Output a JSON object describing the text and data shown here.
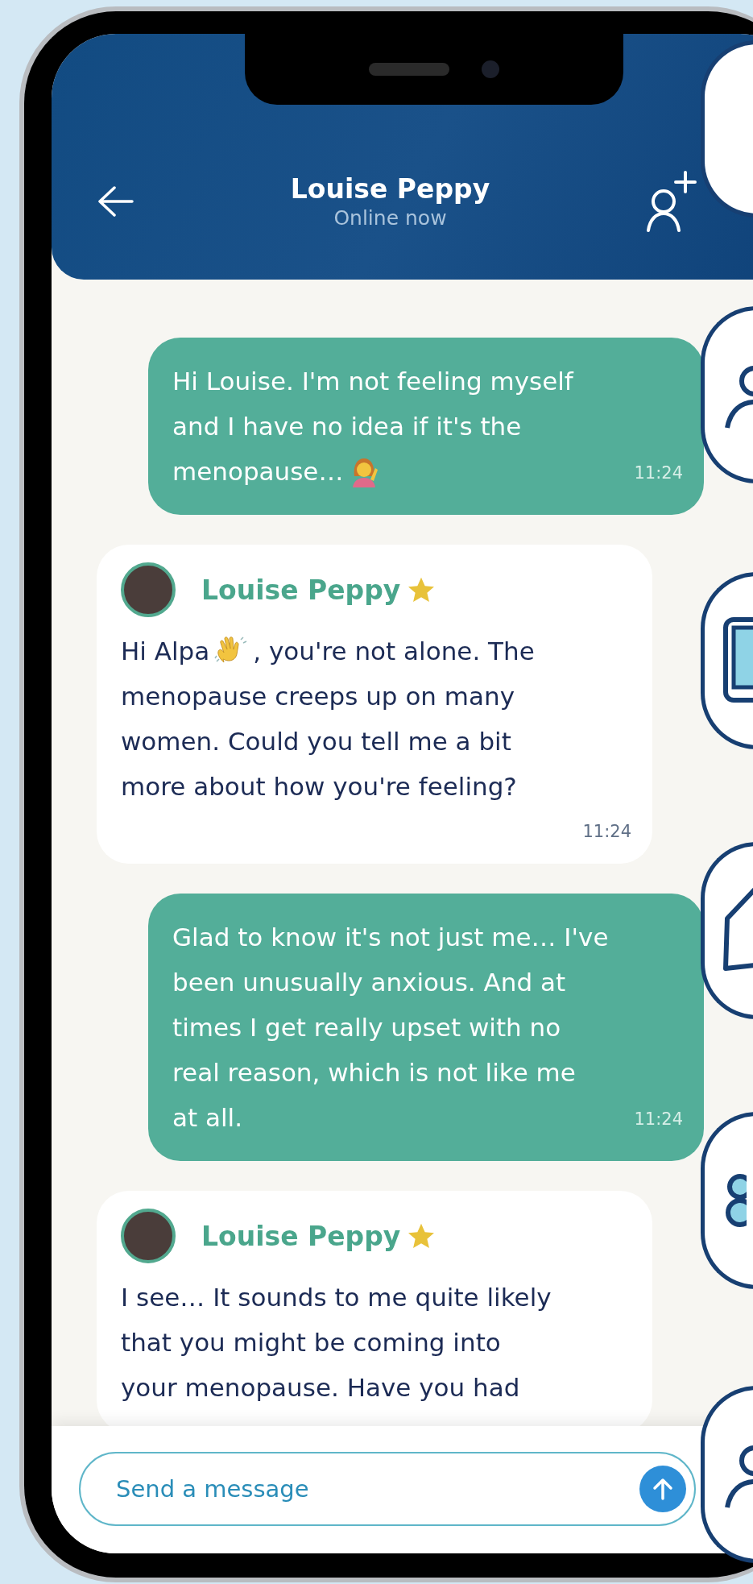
{
  "header": {
    "title": "Louise Peppy",
    "subtitle": "Online now"
  },
  "messages": [
    {
      "kind": "sent",
      "rows": [
        [
          {
            "kind": "text",
            "text": "Hi Louise. I'm not feeling myself\nand I have no idea if it's the"
          }
        ],
        [
          {
            "kind": "text",
            "text": "menopause…"
          },
          {
            "kind": "woman-emoji"
          }
        ]
      ],
      "time": "11:24"
    },
    {
      "kind": "received",
      "sender": "Louise Peppy",
      "starred": true,
      "rows": [
        [
          {
            "kind": "text",
            "text": "Hi Alpa"
          },
          {
            "kind": "wave-emoji"
          },
          {
            "kind": "text",
            "text": ", you're not alone. The"
          }
        ],
        [
          {
            "kind": "text",
            "text": "menopause creeps up on many\nwomen. Could you tell me a bit\nmore about how you're feeling?"
          }
        ]
      ],
      "time": "11:24"
    },
    {
      "kind": "sent",
      "rows": [
        [
          {
            "kind": "text",
            "text": "Glad to know it's not just me… I've\nbeen unusually anxious. And at\ntimes I get really upset with no\nreal reason, which is not like me\nat all."
          }
        ]
      ],
      "time": "11:24"
    },
    {
      "kind": "received",
      "sender": "Louise Peppy",
      "starred": true,
      "rows": [
        [
          {
            "kind": "text",
            "text": "I see… It sounds to me quite likely\nthat you might be coming into\nyour menopause. Have you had"
          }
        ]
      ]
    }
  ],
  "composer": {
    "placeholder": "Send a message"
  },
  "side_buttons": [
    {
      "kind": "blank"
    },
    {
      "kind": "person"
    },
    {
      "kind": "tablet"
    },
    {
      "kind": "house"
    },
    {
      "kind": "figure-eight"
    },
    {
      "kind": "person"
    }
  ]
}
